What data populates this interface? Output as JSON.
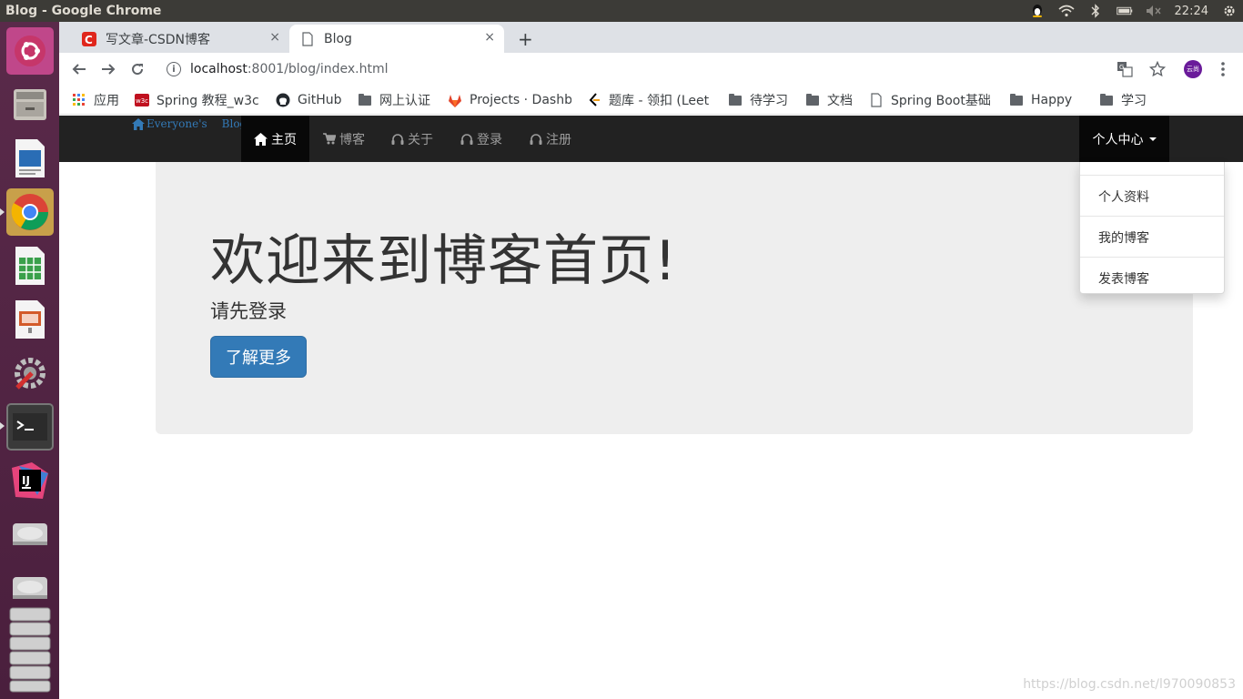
{
  "os": {
    "window_title": "Blog - Google Chrome",
    "clock": "22:24"
  },
  "browser": {
    "tabs": [
      {
        "label": "写文章-CSDN博客",
        "favicon": "csdn-icon"
      },
      {
        "label": "Blog",
        "favicon": "page-icon"
      }
    ],
    "new_tab": "+",
    "close_glyph": "×",
    "url_host": "localhost",
    "url_path": ":8001/blog/index.html",
    "avatar_text": "云尚",
    "bookmarks": [
      {
        "label": "应用",
        "icon": "apps-grid-icon"
      },
      {
        "label": "Spring 教程_w3c",
        "icon": "w3c-icon"
      },
      {
        "label": "GitHub",
        "icon": "github-icon"
      },
      {
        "label": "网上认证",
        "icon": "folder-icon"
      },
      {
        "label": "Projects · Dashb",
        "icon": "gitlab-icon"
      },
      {
        "label": "题库 - 领扣 (Leet",
        "icon": "leetcode-icon"
      },
      {
        "label": "待学习",
        "icon": "folder-icon"
      },
      {
        "label": "文档",
        "icon": "folder-icon"
      },
      {
        "label": "Spring Boot基础",
        "icon": "page-icon"
      },
      {
        "label": "Happy",
        "icon": "folder-icon"
      },
      {
        "label": "学习",
        "icon": "folder-icon"
      }
    ]
  },
  "site": {
    "brand_part1": "Everyone's",
    "brand_part2": "Blog",
    "nav": [
      {
        "label": "主页",
        "icon": "home-icon",
        "active": true
      },
      {
        "label": "博客",
        "icon": "cart-icon",
        "active": false
      },
      {
        "label": "关于",
        "icon": "headphones-icon",
        "active": false
      },
      {
        "label": "登录",
        "icon": "headphones-icon",
        "active": false
      },
      {
        "label": "注册",
        "icon": "headphones-icon",
        "active": false
      }
    ],
    "user_menu": {
      "label": "个人中心",
      "items": [
        "个人资料",
        "我的博客",
        "发表博客"
      ]
    },
    "jumbotron": {
      "heading": "欢迎来到博客首页!",
      "lead": "请先登录",
      "button": "了解更多"
    },
    "watermark": "https://blog.csdn.net/l970090853"
  },
  "colors": {
    "navbar": "#222222",
    "primary": "#337ab7",
    "jumbotron": "#eeeeee"
  }
}
